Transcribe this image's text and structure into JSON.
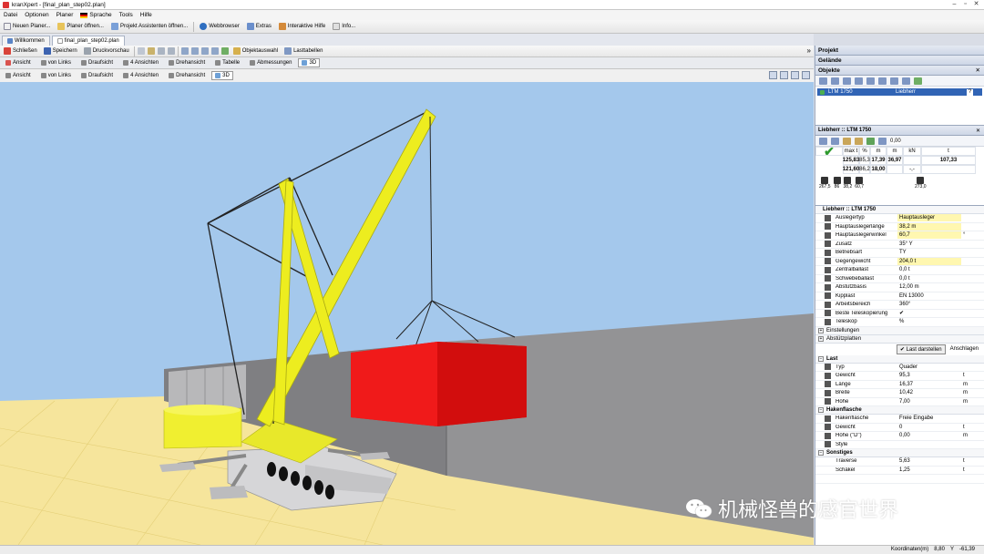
{
  "app": {
    "title": "kranXpert - [final_plan_step02.plan]",
    "window_controls": [
      "–",
      "▫",
      "✕"
    ]
  },
  "menu": [
    "Datei",
    "Optionen",
    "Planer",
    "Sprache",
    "Tools",
    "Hilfe"
  ],
  "toolbar_main": [
    "Neuen Planer...",
    "Planer öffnen...",
    "Projekt Assistenten öffnen...",
    "Webbrowser",
    "Extras",
    "Interaktive Hilfe",
    "Info..."
  ],
  "doc_tabs": [
    "Willkommen",
    "final_plan_step02.plan"
  ],
  "toolbar_secondary": [
    "Schließen",
    "Speichern",
    "Druckvorschau",
    "Objektauswahl",
    "Lasttabellen"
  ],
  "view_tabs": [
    "Ansicht",
    "von Links",
    "Draufsicht",
    "4 Ansichten",
    "Drehansicht",
    "Tabelle",
    "Abmessungen",
    "3D"
  ],
  "sub_view_tabs": [
    "Ansicht",
    "von Links",
    "Draufsicht",
    "4 Ansichten",
    "Drehansicht",
    "3D"
  ],
  "panels": {
    "projekt": "Projekt",
    "gelaende": "Gelände",
    "objekte": "Objekte"
  },
  "objects": [
    {
      "name": "LTM 1750",
      "manufacturer": "Liebherr",
      "flag": "?"
    }
  ],
  "crane": {
    "header": "Liebherr :: LTM 1750",
    "header_value": "0,00",
    "metric_labels": [
      "max t",
      "t",
      "%",
      "m",
      "m",
      "kN"
    ],
    "row1": [
      "125,83",
      "107,33",
      "85,3",
      "17,39",
      "36,97",
      ""
    ],
    "row2": [
      "121,60",
      "",
      "86,2",
      "18,00",
      "",
      "-,-"
    ],
    "icon_values": [
      "267,5",
      "86",
      "38,2",
      "60,7",
      "",
      "",
      "",
      "",
      "",
      "",
      "",
      "",
      "",
      "273,0"
    ],
    "subtitle": "Liebherr :: LTM 1750"
  },
  "properties": [
    {
      "label": "Auslegertyp",
      "value": "Hauptausleger",
      "unit": "",
      "hl": true
    },
    {
      "label": "Hauptauslegerlänge",
      "value": "38,2 m",
      "unit": "",
      "hl": true
    },
    {
      "label": "Hauptauslegerwinkel",
      "value": "60,7",
      "unit": "°",
      "hl": true
    },
    {
      "label": "Zusatz",
      "value": "35° Y",
      "unit": "",
      "hl": false
    },
    {
      "label": "Betriebsart",
      "value": "TY",
      "unit": "",
      "hl": false
    },
    {
      "label": "Gegengewicht",
      "value": "204,0 t",
      "unit": "",
      "hl": true
    },
    {
      "label": "Zentralballast",
      "value": "0,0 t",
      "unit": "",
      "hl": false
    },
    {
      "label": "Schwebeballast",
      "value": "0,0 t",
      "unit": "",
      "hl": false
    },
    {
      "label": "Abstützbasis",
      "value": "12,00 m",
      "unit": "",
      "hl": false
    },
    {
      "label": "Kipplast",
      "value": "EN 13000",
      "unit": "",
      "hl": false
    },
    {
      "label": "Arbeitsbereich",
      "value": "360°",
      "unit": "",
      "hl": false
    },
    {
      "label": "Beste Teleskopierung",
      "value": "✔",
      "unit": "",
      "hl": false
    },
    {
      "label": "Teleskop",
      "value": "%",
      "unit": "",
      "hl": false
    }
  ],
  "collapsed_sections": [
    "Einstellungen",
    "Abstützplatten"
  ],
  "buttons": {
    "show_load": "Last darstellen",
    "attach": "Anschlagen"
  },
  "last": {
    "title": "Last",
    "rows": [
      {
        "label": "Typ",
        "value": "Quader",
        "unit": ""
      },
      {
        "label": "Gewicht",
        "value": "95,3",
        "unit": "t"
      },
      {
        "label": "Länge",
        "value": "16,37",
        "unit": "m"
      },
      {
        "label": "Breite",
        "value": "10,42",
        "unit": "m"
      },
      {
        "label": "Höhe",
        "value": "7,00",
        "unit": "m"
      }
    ]
  },
  "hakenflasche": {
    "title": "Hakenflasche",
    "rows": [
      {
        "label": "Hakenflasche",
        "value": "Freie Eingabe",
        "unit": ""
      },
      {
        "label": "Gewicht",
        "value": "0",
        "unit": "t"
      },
      {
        "label": "Höhe (\"D\")",
        "value": "0,00",
        "unit": "m"
      },
      {
        "label": "Style",
        "value": "",
        "unit": ""
      }
    ]
  },
  "sonstiges": {
    "title": "Sonstiges",
    "rows": [
      {
        "label": "Traverse",
        "value": "5,63",
        "unit": "t"
      },
      {
        "label": "Schäkel",
        "value": "1,25",
        "unit": "t"
      },
      {
        "label": "",
        "value": "",
        "unit": ""
      }
    ]
  },
  "status": {
    "label": "Koordinaten(m)",
    "x": "8,80",
    "y_label": "Y",
    "y": "-61,39"
  },
  "watermark": "机械怪兽的感官世界",
  "colors": {
    "sky": "#a4c8ec",
    "ground": "#f6e59c",
    "wall": "#8e8e90",
    "crane_yellow": "#ecec1a",
    "load_red": "#ee1111",
    "selection": "#3164b5",
    "highlight": "#fff7b0"
  }
}
